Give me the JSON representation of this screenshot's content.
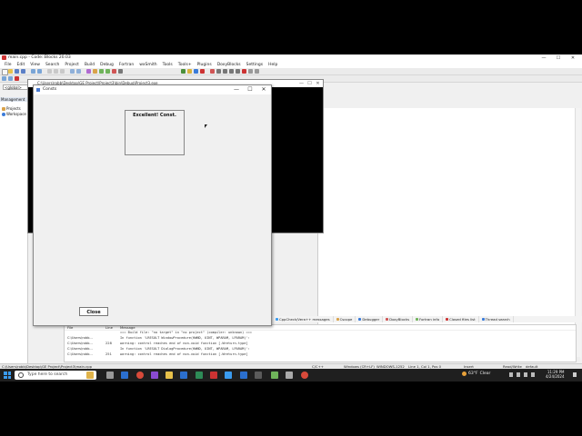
{
  "ide": {
    "title": "main.cpp - Code::Blocks 20.03",
    "menu": [
      "File",
      "Edit",
      "View",
      "Search",
      "Project",
      "Build",
      "Debug",
      "Fortran",
      "wxSmith",
      "Tools",
      "Tools+",
      "Plugins",
      "DoxyBlocks",
      "Settings",
      "Help"
    ],
    "global_scope": "<global>",
    "management_header": "Management",
    "tree": [
      "Projects",
      "Workspace"
    ]
  },
  "console_window": {
    "title": "C:\\Users\\robb\\Desktop\\GE Project\\Project3\\bin\\Debug\\Project3.exe"
  },
  "dialog": {
    "title": "Consts",
    "message": "Excellent! Const.",
    "close_label": "Close",
    "controls": {
      "minimize": "—",
      "maximize": "☐",
      "close": "✕"
    }
  },
  "log_tabs": [
    "CppCheck/Vera++ messages",
    "Cscope",
    "Debugger",
    "DoxyBlocks",
    "Fortran info",
    "Closed files list",
    "Thread search"
  ],
  "log": {
    "headers": [
      "File",
      "Line",
      "Message"
    ],
    "rows": [
      {
        "file": "",
        "line": "",
        "message": "=== Build file: \"no target\" in \"no project\" (compiler: unknown) ==="
      },
      {
        "file": "C:\\Users\\robb...",
        "line": "",
        "message": "In function 'LRESULT WindowProcedure(HWND, UINT, WPARAM, LPARAM)':"
      },
      {
        "file": "C:\\Users\\robb...",
        "line": "228",
        "message": "warning: control reaches end of non-void function [-Wreturn-type]"
      },
      {
        "file": "C:\\Users\\robb...",
        "line": "",
        "message": "In function 'LRESULT DialogProcedure(HWND, UINT, WPARAM, LPARAM)':"
      },
      {
        "file": "C:\\Users\\robb...",
        "line": "251",
        "message": "warning: control reaches end of non-void function [-Wreturn-type]"
      }
    ]
  },
  "statusbar": {
    "path": "C:\\Users\\robb\\Desktop\\GE Project\\Project3\\main.cpp",
    "lang": "C/C++",
    "eol": "Windows (CR+LF)",
    "encoding": "WINDOWS-1252",
    "position": "Line 1, Col 1, Pos 0",
    "mode": "Insert",
    "access": "Read/Write",
    "profile": "default"
  },
  "taskbar": {
    "search_placeholder": "Type here to search",
    "weather_temp": "63°F",
    "weather_text": "Clear",
    "time": "11:29 PM",
    "date": "4/24/2024"
  },
  "colors": {
    "accent": "#3a9bef",
    "taskbar": "#1f1f1f",
    "dialog_bg": "#f0f0f0"
  }
}
